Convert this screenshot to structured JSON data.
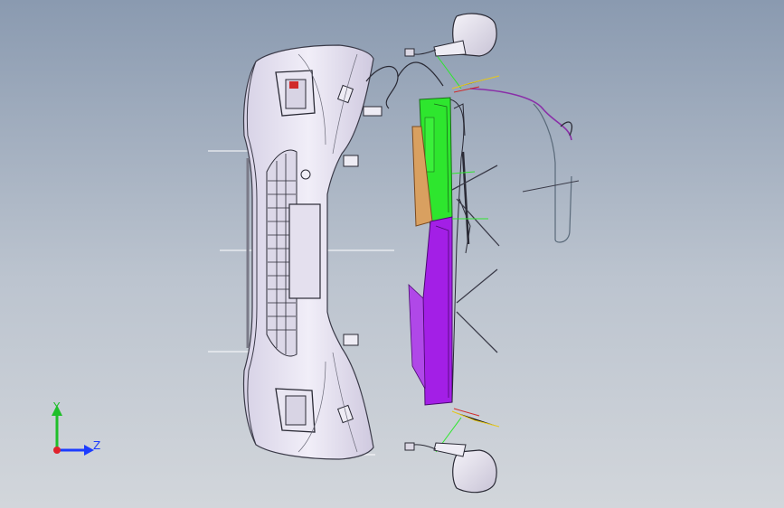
{
  "window": {
    "title": ""
  },
  "triad": {
    "y_label": "Y",
    "z_label": "Z",
    "colors": {
      "y": "#1fbf2a",
      "z": "#1c3cff",
      "x": "#e0222c"
    }
  },
  "scene": {
    "description_colors": {
      "background_top": "#8a9ab0",
      "background_bottom": "#d2d6db",
      "bumper_fill": "#e6e2f2",
      "bracket_green": "#2ee62e",
      "bracket_purple": "#a31fe6",
      "bracket_orange": "#d99a5a",
      "wire_purple": "#8a2fa8",
      "line_dark": "#2a2a35"
    }
  }
}
